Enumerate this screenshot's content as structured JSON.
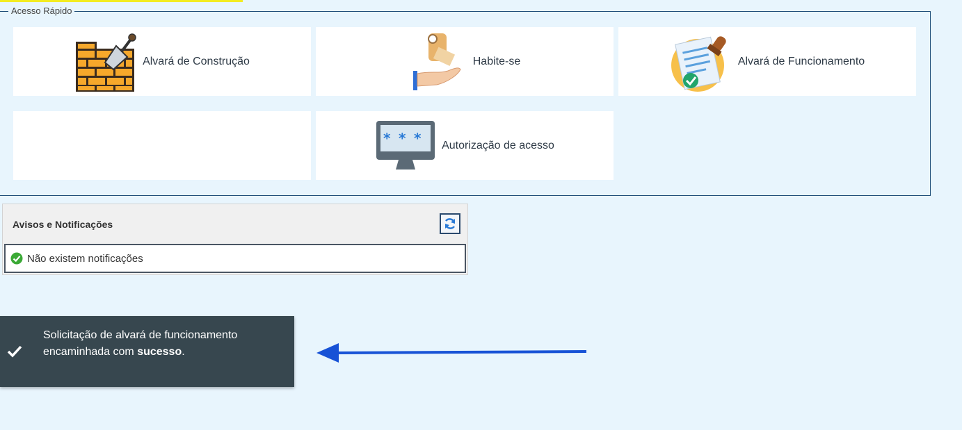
{
  "quick_access": {
    "legend": "Acesso Rápido",
    "tiles": [
      {
        "label": "Alvará de Construção",
        "icon": "brick-wall-trowel-icon"
      },
      {
        "label": "Habite-se",
        "icon": "hand-key-icon"
      },
      {
        "label": "Alvará de Funcionamento",
        "icon": "document-stamp-icon"
      },
      {
        "label": "",
        "icon": ""
      },
      {
        "label": "Autorização de acesso",
        "icon": "monitor-password-icon"
      }
    ]
  },
  "notifications": {
    "title": "Avisos e Notificações",
    "refresh_icon": "refresh-icon",
    "empty_message": "Não existem notificações"
  },
  "toast": {
    "message_prefix": "Solicitação de alvará de funcionamento encaminhada com ",
    "message_bold": "sucesso",
    "message_suffix": ".",
    "icon": "checkmark-icon"
  },
  "colors": {
    "background": "#e8f5fd",
    "border": "#1f4e79",
    "toast_bg": "#37474f",
    "arrow": "#1752d6",
    "accent_bar": "#f3ec22"
  }
}
